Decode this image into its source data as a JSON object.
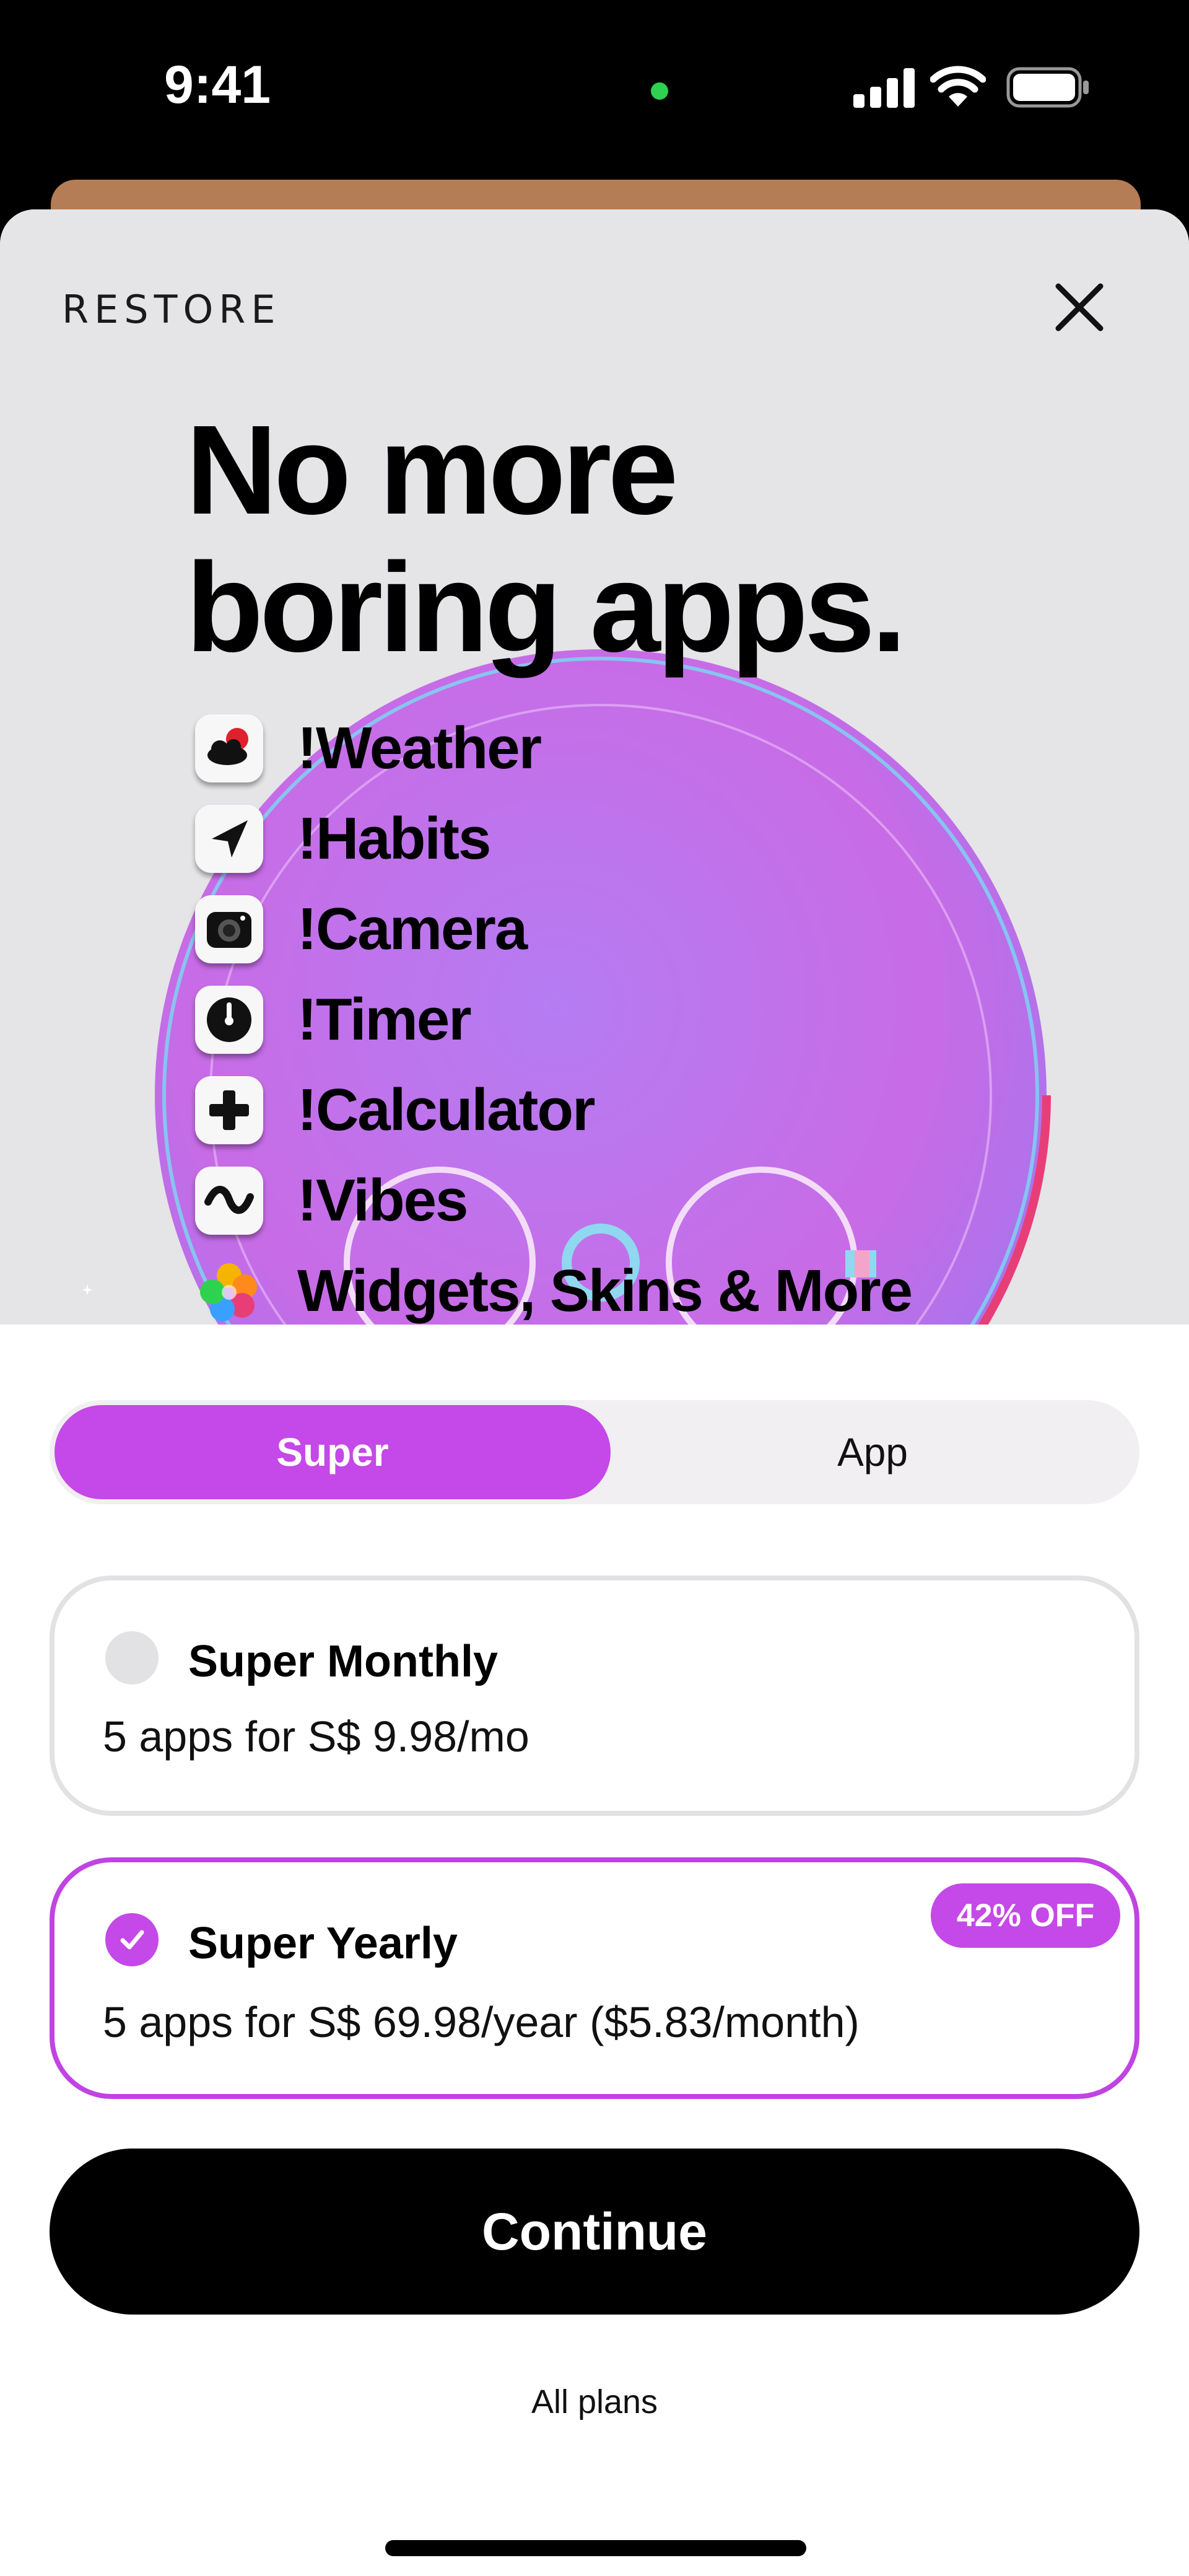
{
  "status_bar": {
    "time": "9:41"
  },
  "header": {
    "restore_label": "RESTORE"
  },
  "hero": {
    "headline_line1": "No more",
    "headline_line2": "boring apps.",
    "features": [
      {
        "label": "!Weather",
        "icon": "weather-icon"
      },
      {
        "label": "!Habits",
        "icon": "habits-icon"
      },
      {
        "label": "!Camera",
        "icon": "camera-icon"
      },
      {
        "label": "!Timer",
        "icon": "timer-icon"
      },
      {
        "label": "!Calculator",
        "icon": "calculator-icon"
      },
      {
        "label": "!Vibes",
        "icon": "vibes-icon"
      },
      {
        "label": "Widgets, Skins & More",
        "icon": "widgets-icon"
      }
    ]
  },
  "tabs": {
    "super_label": "Super",
    "app_label": "App",
    "selected": "Super"
  },
  "plans": [
    {
      "title": "Super Monthly",
      "description": "5 apps for S$ 9.98/mo",
      "selected": false
    },
    {
      "title": "Super Yearly",
      "description": "5 apps for S$ 69.98/year ($5.83/month)",
      "badge": "42% OFF",
      "selected": true
    }
  ],
  "actions": {
    "continue_label": "Continue",
    "all_plans_label": "All plans"
  },
  "colors": {
    "accent": "#C548E8",
    "button": "#000000",
    "hero_bg": "#E5E4E6"
  }
}
